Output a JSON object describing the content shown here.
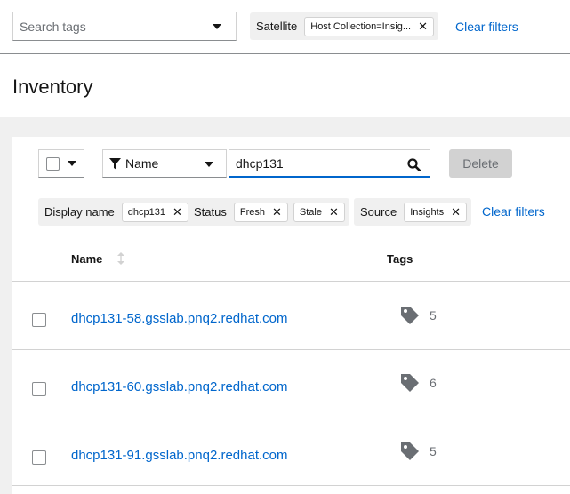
{
  "global_filter": {
    "tag_search_placeholder": "Search tags",
    "chip_groups": [
      {
        "category": "Satellite",
        "chips": [
          "Host Collection=Insig..."
        ]
      }
    ],
    "clear_filters_label": "Clear filters"
  },
  "page": {
    "title": "Inventory"
  },
  "toolbar": {
    "attribute_selected": "Name",
    "search_value": "dhcp131",
    "delete_label": "Delete"
  },
  "active_filters": {
    "groups": [
      {
        "category": "Display name",
        "chips": [
          "dhcp131"
        ]
      },
      {
        "category": "Status",
        "chips": [
          "Fresh",
          "Stale"
        ]
      },
      {
        "category": "Source",
        "chips": [
          "Insights"
        ]
      }
    ],
    "clear_filters_label": "Clear filters"
  },
  "table": {
    "columns": [
      "Name",
      "Tags"
    ],
    "rows": [
      {
        "name": "dhcp131-58.gsslab.pnq2.redhat.com",
        "tags": "5"
      },
      {
        "name": "dhcp131-60.gsslab.pnq2.redhat.com",
        "tags": "6"
      },
      {
        "name": "dhcp131-91.gsslab.pnq2.redhat.com",
        "tags": "5"
      }
    ]
  },
  "colors": {
    "link": "#0066cc",
    "chip_group_bg": "#f0f0f0",
    "page_bg": "#f0f0f0",
    "disabled_button": "#d2d2d2"
  }
}
